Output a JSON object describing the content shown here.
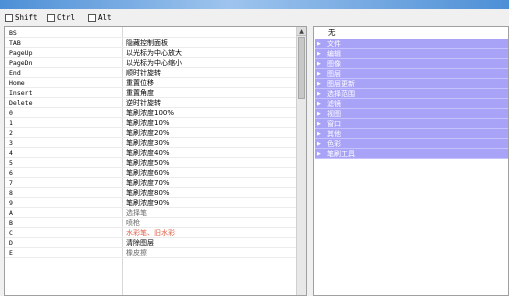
{
  "modifiers": [
    {
      "label": "Shift",
      "checked": false
    },
    {
      "label": "Ctrl",
      "checked": false
    },
    {
      "label": "Alt",
      "checked": false
    }
  ],
  "shortcuts": [
    {
      "key": "BS",
      "action": ""
    },
    {
      "key": "TAB",
      "action": "隐藏控制面板"
    },
    {
      "key": "PageUp",
      "action": "以光标为中心放大"
    },
    {
      "key": "PageDn",
      "action": "以光标为中心缩小"
    },
    {
      "key": "End",
      "action": "顺时针旋转"
    },
    {
      "key": "Home",
      "action": "重置位移"
    },
    {
      "key": "Insert",
      "action": "重置角度"
    },
    {
      "key": "Delete",
      "action": "逆时针旋转"
    },
    {
      "key": "0",
      "action": "笔刷浓度100%"
    },
    {
      "key": "1",
      "action": "笔刷浓度10%"
    },
    {
      "key": "2",
      "action": "笔刷浓度20%"
    },
    {
      "key": "3",
      "action": "笔刷浓度30%"
    },
    {
      "key": "4",
      "action": "笔刷浓度40%"
    },
    {
      "key": "5",
      "action": "笔刷浓度50%"
    },
    {
      "key": "6",
      "action": "笔刷浓度60%"
    },
    {
      "key": "7",
      "action": "笔刷浓度70%"
    },
    {
      "key": "8",
      "action": "笔刷浓度80%"
    },
    {
      "key": "9",
      "action": "笔刷浓度90%"
    },
    {
      "key": "A",
      "action": "选择笔"
    },
    {
      "key": "B",
      "action": "喷枪"
    },
    {
      "key": "C",
      "action": "水彩笔、旧水彩"
    },
    {
      "key": "D",
      "action": "清除图层"
    },
    {
      "key": "E",
      "action": "橡皮擦"
    }
  ],
  "action_colors": {
    "A": "#6a6a6a",
    "B": "#6a6a6a",
    "C": "#e0604a",
    "E": "#6a6a6a"
  },
  "right_header": "无",
  "categories": [
    "文件",
    "编辑",
    "图像",
    "图层",
    "图层更新",
    "选择范围",
    "滤镜",
    "视图",
    "窗口",
    "其他",
    "色彩",
    "笔刷工具"
  ],
  "colors": {
    "category_bg": "#a9a3f8",
    "titlebar": "#4d8fd6"
  },
  "icons": {
    "category_arrow": "triangle-right-icon",
    "scroll_up": "arrow-up-icon"
  }
}
